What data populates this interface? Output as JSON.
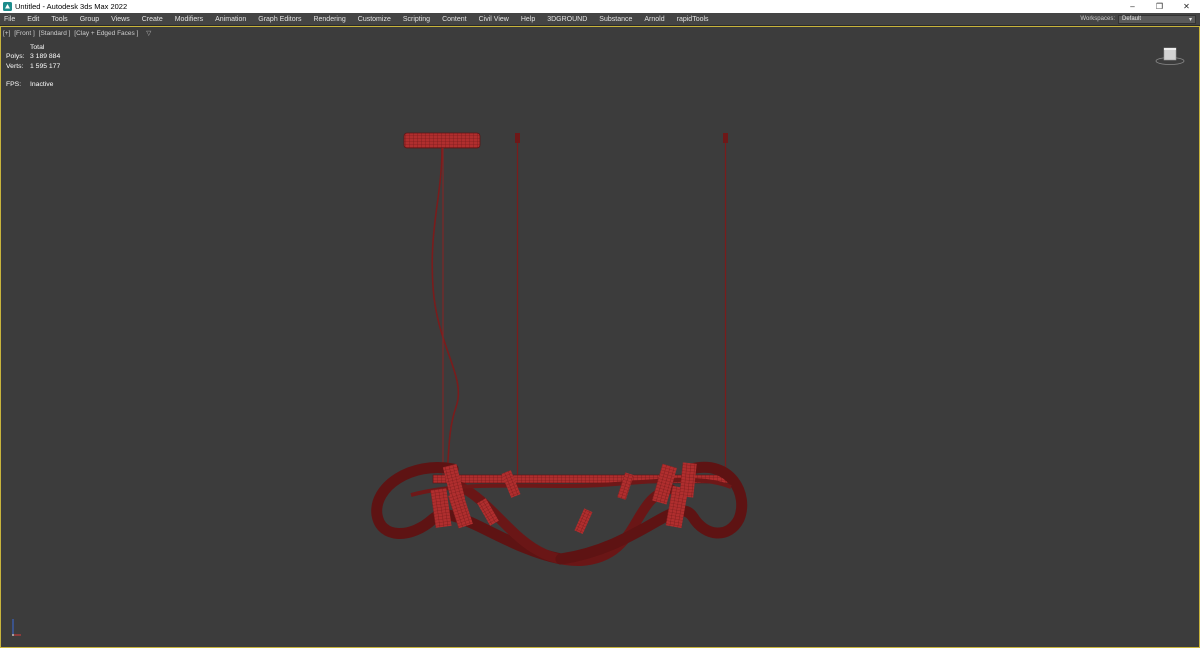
{
  "window": {
    "title": "Untitled - Autodesk 3ds Max 2022",
    "controls": {
      "minimize": "–",
      "restore": "❐",
      "close": "✕"
    }
  },
  "menubar": {
    "items": [
      "File",
      "Edit",
      "Tools",
      "Group",
      "Views",
      "Create",
      "Modifiers",
      "Animation",
      "Graph Editors",
      "Rendering",
      "Customize",
      "Scripting",
      "Content",
      "Civil View",
      "Help",
      "3DGROUND",
      "Substance",
      "Arnold",
      "rapidTools"
    ],
    "workspace_label": "Workspaces:",
    "workspace_value": "Default"
  },
  "viewport": {
    "label_segments": [
      "[+]",
      "[Front ]",
      "[Standard ]",
      "[Clay + Edged Faces ]"
    ],
    "filter_icon": "funnel-icon",
    "stats": {
      "header": "Total",
      "polys_label": "Polys:",
      "polys_value": "3 189 884",
      "verts_label": "Verts:",
      "verts_value": "1 595 177",
      "fps_label": "FPS:",
      "fps_value": "Inactive"
    },
    "border_color": "#c8b43c",
    "background": "#3c3c3c",
    "model_color": "#b23030"
  }
}
